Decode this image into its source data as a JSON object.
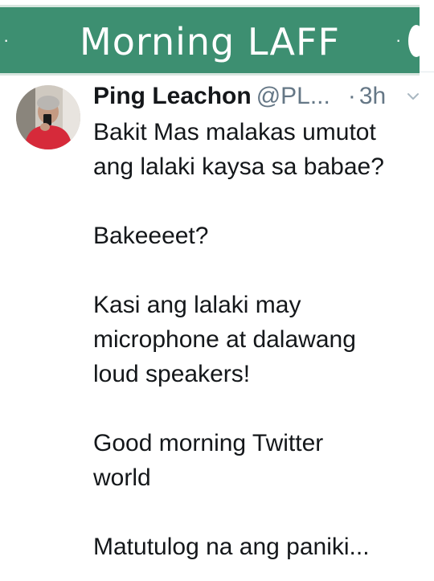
{
  "banner": {
    "title": "Morning LAFF",
    "ornament_left": "·",
    "ornament_right": "·",
    "background_color": "#3d8f71"
  },
  "tweet": {
    "author": {
      "display_name": "Ping Leachon",
      "handle": "@PL...",
      "avatar_icon": "profile-photo"
    },
    "separator": "·",
    "timestamp": "3h",
    "menu_icon": "chevron-down-icon",
    "paragraphs": [
      [
        "Bakit Mas malakas umutot",
        "ang lalaki kaysa sa babae?"
      ],
      [
        "Bakeeeet?"
      ],
      [
        "Kasi ang lalaki may",
        "microphone at dalawang",
        "loud speakers!"
      ],
      [
        "Good morning Twitter",
        "world"
      ],
      [
        "Matutulog na ang paniki..."
      ]
    ]
  }
}
